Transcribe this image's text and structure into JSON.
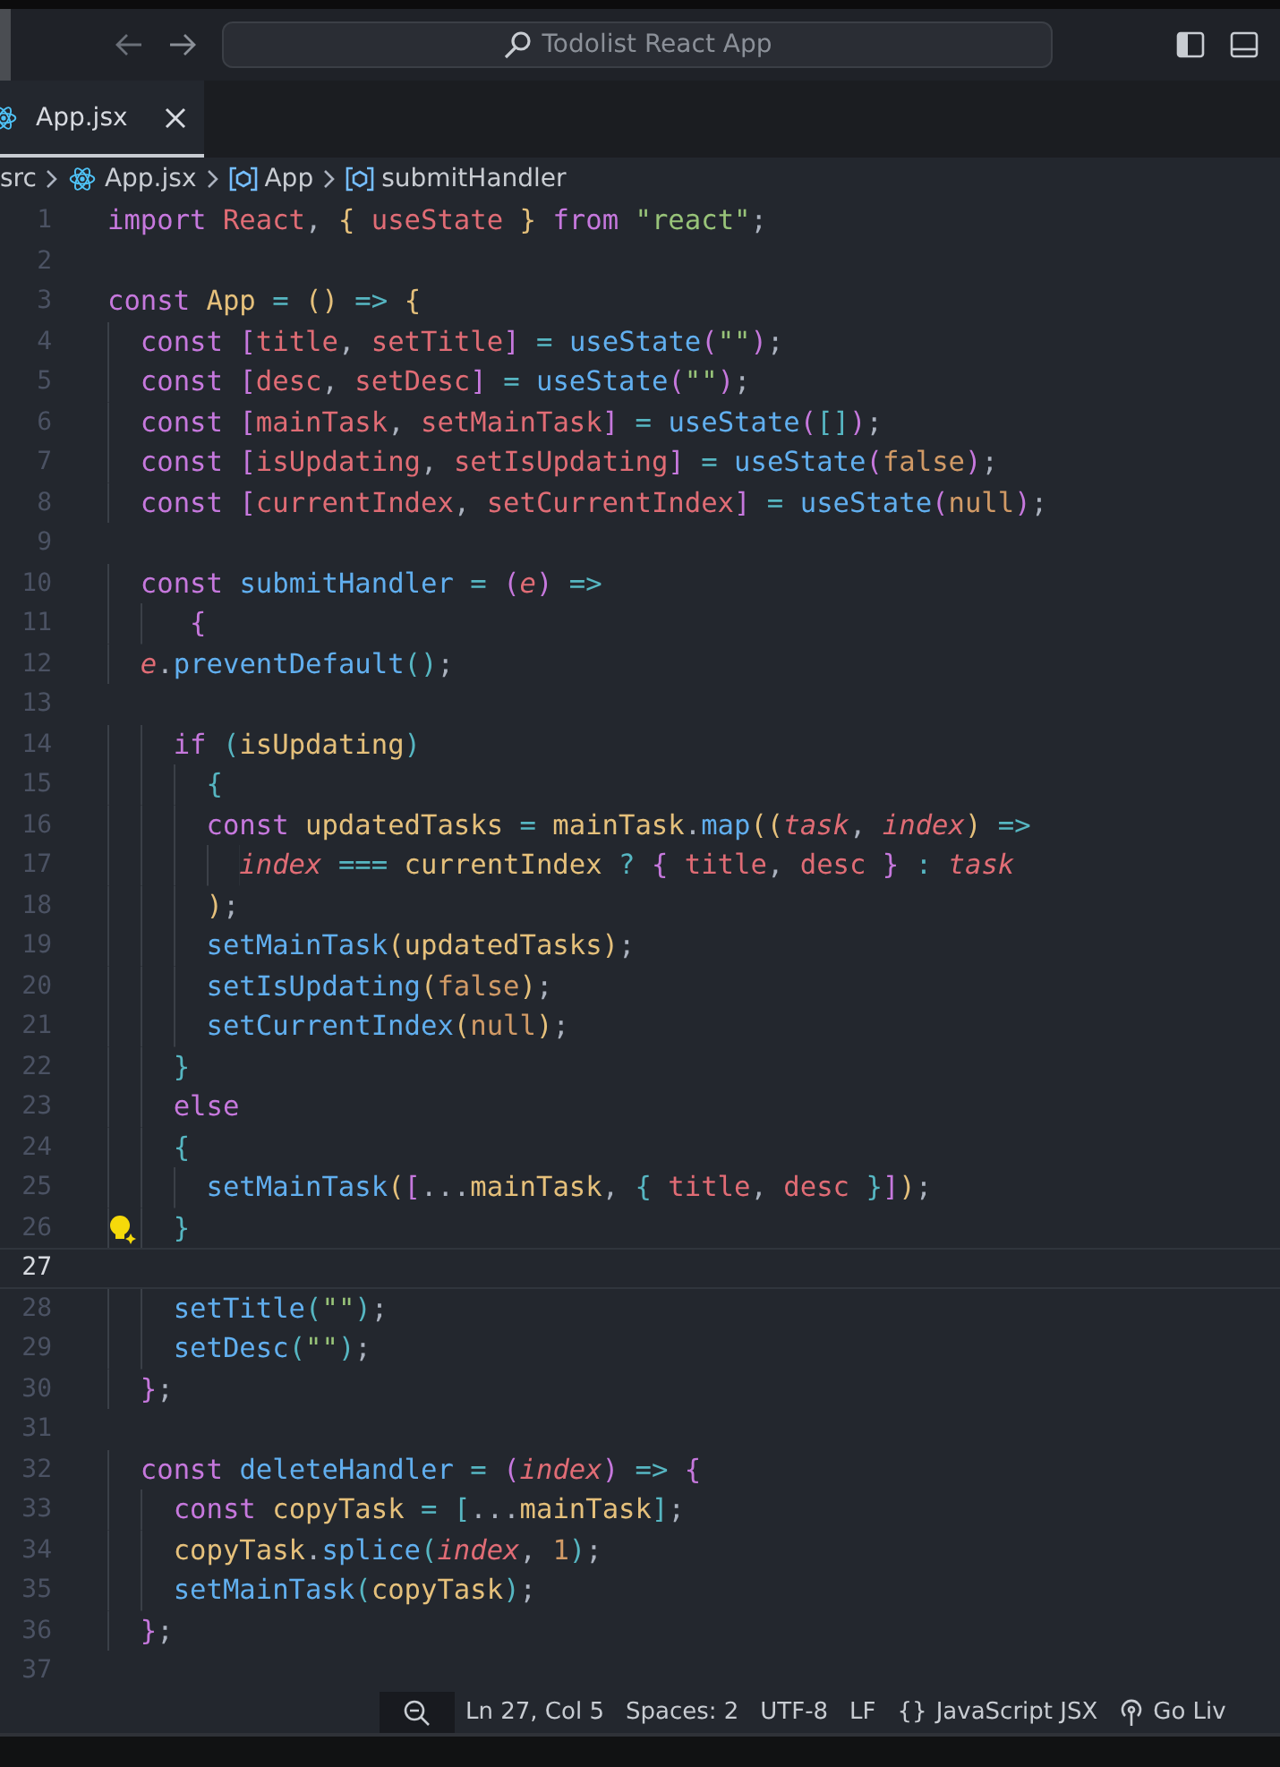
{
  "titlebar": {
    "search": {
      "value": "Todolist React App"
    }
  },
  "tabs": [
    {
      "label": "App.jsx",
      "selected": true
    }
  ],
  "breadcrumb": [
    {
      "label": "src",
      "kind": "folder"
    },
    {
      "label": "App.jsx",
      "kind": "file"
    },
    {
      "label": "App",
      "kind": "symbol"
    },
    {
      "label": "submitHandler",
      "kind": "symbol"
    }
  ],
  "editor": {
    "lines": [
      {
        "number": "1",
        "tokens": [
          {
            "kind": "kw",
            "text": "import "
          },
          {
            "kind": "id",
            "text": "React"
          },
          {
            "kind": "p",
            "text": ", "
          },
          {
            "kind": "b1",
            "text": "{"
          },
          {
            "kind": "id",
            "text": " useState "
          },
          {
            "kind": "b1",
            "text": "} "
          },
          {
            "kind": "kw",
            "text": "from "
          },
          {
            "kind": "str",
            "text": "\"react\""
          },
          {
            "kind": "p",
            "text": ";"
          }
        ]
      },
      {
        "number": "2"
      },
      {
        "number": "3",
        "tokens": [
          {
            "kind": "kw",
            "text": "const "
          },
          {
            "kind": "var",
            "text": "App"
          },
          {
            "kind": "op",
            "text": " = "
          },
          {
            "kind": "b1",
            "text": "()"
          },
          {
            "kind": "op",
            "text": " => "
          },
          {
            "kind": "b1",
            "text": "{"
          }
        ]
      },
      {
        "number": "4",
        "tokens": [
          {
            "kind": "kw",
            "text": "  const "
          },
          {
            "kind": "b2",
            "text": "["
          },
          {
            "kind": "id",
            "text": "title"
          },
          {
            "kind": "p",
            "text": ", "
          },
          {
            "kind": "id",
            "text": "setTitle"
          },
          {
            "kind": "b2",
            "text": "]"
          },
          {
            "kind": "op",
            "text": " = "
          },
          {
            "kind": "fn",
            "text": "useState"
          },
          {
            "kind": "b2",
            "text": "("
          },
          {
            "kind": "str",
            "text": "\"\""
          },
          {
            "kind": "b2",
            "text": ")"
          },
          {
            "kind": "p",
            "text": ";"
          }
        ]
      },
      {
        "number": "5",
        "tokens": [
          {
            "kind": "kw",
            "text": "  const "
          },
          {
            "kind": "b2",
            "text": "["
          },
          {
            "kind": "id",
            "text": "desc"
          },
          {
            "kind": "p",
            "text": ", "
          },
          {
            "kind": "id",
            "text": "setDesc"
          },
          {
            "kind": "b2",
            "text": "]"
          },
          {
            "kind": "op",
            "text": " = "
          },
          {
            "kind": "fn",
            "text": "useState"
          },
          {
            "kind": "b2",
            "text": "("
          },
          {
            "kind": "str",
            "text": "\"\""
          },
          {
            "kind": "b2",
            "text": ")"
          },
          {
            "kind": "p",
            "text": ";"
          }
        ]
      },
      {
        "number": "6",
        "tokens": [
          {
            "kind": "kw",
            "text": "  const "
          },
          {
            "kind": "b2",
            "text": "["
          },
          {
            "kind": "id",
            "text": "mainTask"
          },
          {
            "kind": "p",
            "text": ", "
          },
          {
            "kind": "id",
            "text": "setMainTask"
          },
          {
            "kind": "b2",
            "text": "]"
          },
          {
            "kind": "op",
            "text": " = "
          },
          {
            "kind": "fn",
            "text": "useState"
          },
          {
            "kind": "b2",
            "text": "("
          },
          {
            "kind": "b3",
            "text": "[]"
          },
          {
            "kind": "b2",
            "text": ")"
          },
          {
            "kind": "p",
            "text": ";"
          }
        ]
      },
      {
        "number": "7",
        "tokens": [
          {
            "kind": "kw",
            "text": "  const "
          },
          {
            "kind": "b2",
            "text": "["
          },
          {
            "kind": "id",
            "text": "isUpdating"
          },
          {
            "kind": "p",
            "text": ", "
          },
          {
            "kind": "id",
            "text": "setIsUpdating"
          },
          {
            "kind": "b2",
            "text": "]"
          },
          {
            "kind": "op",
            "text": " = "
          },
          {
            "kind": "fn",
            "text": "useState"
          },
          {
            "kind": "b2",
            "text": "("
          },
          {
            "kind": "num",
            "text": "false"
          },
          {
            "kind": "b2",
            "text": ")"
          },
          {
            "kind": "p",
            "text": ";"
          }
        ]
      },
      {
        "number": "8",
        "tokens": [
          {
            "kind": "kw",
            "text": "  const "
          },
          {
            "kind": "b2",
            "text": "["
          },
          {
            "kind": "id",
            "text": "currentIndex"
          },
          {
            "kind": "p",
            "text": ", "
          },
          {
            "kind": "id",
            "text": "setCurrentIndex"
          },
          {
            "kind": "b2",
            "text": "]"
          },
          {
            "kind": "op",
            "text": " = "
          },
          {
            "kind": "fn",
            "text": "useState"
          },
          {
            "kind": "b2",
            "text": "("
          },
          {
            "kind": "num",
            "text": "null"
          },
          {
            "kind": "b2",
            "text": ")"
          },
          {
            "kind": "p",
            "text": ";"
          }
        ]
      },
      {
        "number": "9"
      },
      {
        "number": "10",
        "tokens": [
          {
            "kind": "kw",
            "text": "  const "
          },
          {
            "kind": "fn",
            "text": "submitHandler"
          },
          {
            "kind": "op",
            "text": " = "
          },
          {
            "kind": "b2",
            "text": "("
          },
          {
            "kind": "param",
            "text": "e"
          },
          {
            "kind": "b2",
            "text": ")"
          },
          {
            "kind": "op",
            "text": " =>"
          }
        ]
      },
      {
        "number": "11",
        "tokens": [
          {
            "kind": "b2",
            "text": "     {"
          }
        ]
      },
      {
        "number": "12",
        "tokens": [
          {
            "kind": "param",
            "text": "  e"
          },
          {
            "kind": "p",
            "text": "."
          },
          {
            "kind": "fn",
            "text": "preventDefault"
          },
          {
            "kind": "b3",
            "text": "()"
          },
          {
            "kind": "p",
            "text": ";"
          }
        ]
      },
      {
        "number": "13"
      },
      {
        "number": "14",
        "tokens": [
          {
            "kind": "kw",
            "text": "    if "
          },
          {
            "kind": "b3",
            "text": "("
          },
          {
            "kind": "var",
            "text": "isUpdating"
          },
          {
            "kind": "b3",
            "text": ")"
          }
        ]
      },
      {
        "number": "15",
        "tokens": [
          {
            "kind": "b3",
            "text": "      {"
          }
        ]
      },
      {
        "number": "16",
        "tokens": [
          {
            "kind": "kw",
            "text": "      const "
          },
          {
            "kind": "var",
            "text": "updatedTasks"
          },
          {
            "kind": "op",
            "text": " = "
          },
          {
            "kind": "var",
            "text": "mainTask"
          },
          {
            "kind": "p",
            "text": "."
          },
          {
            "kind": "fn",
            "text": "map"
          },
          {
            "kind": "b1",
            "text": "(("
          },
          {
            "kind": "param",
            "text": "task"
          },
          {
            "kind": "p",
            "text": ", "
          },
          {
            "kind": "param",
            "text": "index"
          },
          {
            "kind": "b1",
            "text": ")"
          },
          {
            "kind": "op",
            "text": " =>"
          }
        ]
      },
      {
        "number": "17",
        "tokens": [
          {
            "kind": "param",
            "text": "        index"
          },
          {
            "kind": "op",
            "text": " === "
          },
          {
            "kind": "var",
            "text": "currentIndex"
          },
          {
            "kind": "op",
            "text": " ? "
          },
          {
            "kind": "b2",
            "text": "{"
          },
          {
            "kind": "id",
            "text": " title"
          },
          {
            "kind": "p",
            "text": ", "
          },
          {
            "kind": "id",
            "text": "desc "
          },
          {
            "kind": "b2",
            "text": "}"
          },
          {
            "kind": "op",
            "text": " : "
          },
          {
            "kind": "param",
            "text": "task"
          }
        ]
      },
      {
        "number": "18",
        "tokens": [
          {
            "kind": "b1",
            "text": "      )"
          },
          {
            "kind": "p",
            "text": ";"
          }
        ]
      },
      {
        "number": "19",
        "tokens": [
          {
            "kind": "fn",
            "text": "      setMainTask"
          },
          {
            "kind": "b1",
            "text": "("
          },
          {
            "kind": "var",
            "text": "updatedTasks"
          },
          {
            "kind": "b1",
            "text": ")"
          },
          {
            "kind": "p",
            "text": ";"
          }
        ]
      },
      {
        "number": "20",
        "tokens": [
          {
            "kind": "fn",
            "text": "      setIsUpdating"
          },
          {
            "kind": "b1",
            "text": "("
          },
          {
            "kind": "num",
            "text": "false"
          },
          {
            "kind": "b1",
            "text": ")"
          },
          {
            "kind": "p",
            "text": ";"
          }
        ]
      },
      {
        "number": "21",
        "tokens": [
          {
            "kind": "fn",
            "text": "      setCurrentIndex"
          },
          {
            "kind": "b1",
            "text": "("
          },
          {
            "kind": "num",
            "text": "null"
          },
          {
            "kind": "b1",
            "text": ")"
          },
          {
            "kind": "p",
            "text": ";"
          }
        ]
      },
      {
        "number": "22",
        "tokens": [
          {
            "kind": "b3",
            "text": "    }"
          }
        ]
      },
      {
        "number": "23",
        "tokens": [
          {
            "kind": "kw",
            "text": "    else"
          }
        ]
      },
      {
        "number": "24",
        "tokens": [
          {
            "kind": "b3",
            "text": "    {"
          }
        ]
      },
      {
        "number": "25",
        "tokens": [
          {
            "kind": "fn",
            "text": "      setMainTask"
          },
          {
            "kind": "b1",
            "text": "("
          },
          {
            "kind": "b2",
            "text": "["
          },
          {
            "kind": "p",
            "text": "..."
          },
          {
            "kind": "var",
            "text": "mainTask"
          },
          {
            "kind": "p",
            "text": ", "
          },
          {
            "kind": "b3",
            "text": "{"
          },
          {
            "kind": "id",
            "text": " title"
          },
          {
            "kind": "p",
            "text": ", "
          },
          {
            "kind": "id",
            "text": "desc "
          },
          {
            "kind": "b3",
            "text": "}"
          },
          {
            "kind": "b2",
            "text": "]"
          },
          {
            "kind": "b1",
            "text": ")"
          },
          {
            "kind": "p",
            "text": ";"
          }
        ]
      },
      {
        "number": "26",
        "hint": true,
        "tokens": [
          {
            "kind": "b3",
            "text": "    }"
          }
        ]
      },
      {
        "number": "27",
        "current": true
      },
      {
        "number": "28",
        "tokens": [
          {
            "kind": "fn",
            "text": "    setTitle"
          },
          {
            "kind": "b3",
            "text": "("
          },
          {
            "kind": "str",
            "text": "\"\""
          },
          {
            "kind": "b3",
            "text": ")"
          },
          {
            "kind": "p",
            "text": ";"
          }
        ]
      },
      {
        "number": "29",
        "tokens": [
          {
            "kind": "fn",
            "text": "    setDesc"
          },
          {
            "kind": "b3",
            "text": "("
          },
          {
            "kind": "str",
            "text": "\"\""
          },
          {
            "kind": "b3",
            "text": ")"
          },
          {
            "kind": "p",
            "text": ";"
          }
        ]
      },
      {
        "number": "30",
        "tokens": [
          {
            "kind": "b2",
            "text": "  }"
          },
          {
            "kind": "p",
            "text": ";"
          }
        ]
      },
      {
        "number": "31"
      },
      {
        "number": "32",
        "tokens": [
          {
            "kind": "kw",
            "text": "  const "
          },
          {
            "kind": "fn",
            "text": "deleteHandler"
          },
          {
            "kind": "op",
            "text": " = "
          },
          {
            "kind": "b2",
            "text": "("
          },
          {
            "kind": "param",
            "text": "index"
          },
          {
            "kind": "b2",
            "text": ")"
          },
          {
            "kind": "op",
            "text": " => "
          },
          {
            "kind": "b2",
            "text": "{"
          }
        ]
      },
      {
        "number": "33",
        "tokens": [
          {
            "kind": "kw",
            "text": "    const "
          },
          {
            "kind": "var",
            "text": "copyTask"
          },
          {
            "kind": "op",
            "text": " = "
          },
          {
            "kind": "b3",
            "text": "["
          },
          {
            "kind": "p",
            "text": "..."
          },
          {
            "kind": "var",
            "text": "mainTask"
          },
          {
            "kind": "b3",
            "text": "]"
          },
          {
            "kind": "p",
            "text": ";"
          }
        ]
      },
      {
        "number": "34",
        "tokens": [
          {
            "kind": "var",
            "text": "    copyTask"
          },
          {
            "kind": "p",
            "text": "."
          },
          {
            "kind": "fn",
            "text": "splice"
          },
          {
            "kind": "b3",
            "text": "("
          },
          {
            "kind": "param",
            "text": "index"
          },
          {
            "kind": "p",
            "text": ", "
          },
          {
            "kind": "num",
            "text": "1"
          },
          {
            "kind": "b3",
            "text": ")"
          },
          {
            "kind": "p",
            "text": ";"
          }
        ]
      },
      {
        "number": "35",
        "tokens": [
          {
            "kind": "fn",
            "text": "    setMainTask"
          },
          {
            "kind": "b3",
            "text": "("
          },
          {
            "kind": "var",
            "text": "copyTask"
          },
          {
            "kind": "b3",
            "text": ")"
          },
          {
            "kind": "p",
            "text": ";"
          }
        ]
      },
      {
        "number": "36",
        "tokens": [
          {
            "kind": "b2",
            "text": "  }"
          },
          {
            "kind": "p",
            "text": ";"
          }
        ]
      },
      {
        "number": "37"
      }
    ]
  },
  "status_bar": {
    "items": [
      {
        "kind": "zoom"
      },
      {
        "kind": "text",
        "label": "Ln 27, Col 5"
      },
      {
        "kind": "text",
        "label": "Spaces: 2"
      },
      {
        "kind": "text",
        "label": "UTF-8"
      },
      {
        "kind": "text",
        "label": "LF"
      },
      {
        "kind": "language",
        "icon": "{}",
        "label": "JavaScript JSX"
      },
      {
        "kind": "live",
        "label": "Go Liv"
      }
    ]
  }
}
